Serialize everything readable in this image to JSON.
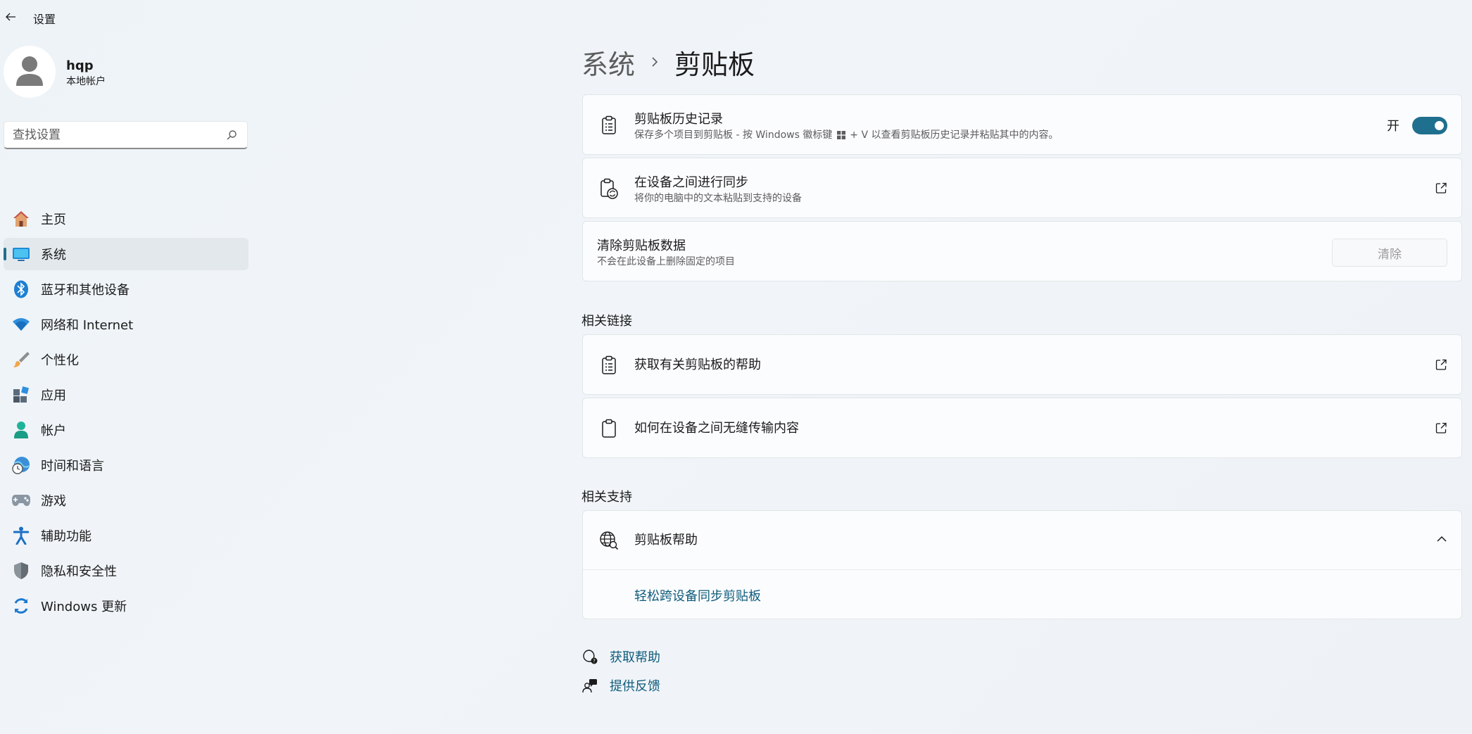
{
  "window": {
    "title": "设置"
  },
  "account": {
    "name": "hqp",
    "type": "本地帐户"
  },
  "search": {
    "placeholder": "查找设置"
  },
  "nav": [
    {
      "label": "主页",
      "icon": "home-icon"
    },
    {
      "label": "系统",
      "icon": "system-icon",
      "selected": true
    },
    {
      "label": "蓝牙和其他设备",
      "icon": "bluetooth-icon"
    },
    {
      "label": "网络和 Internet",
      "icon": "wifi-icon"
    },
    {
      "label": "个性化",
      "icon": "brush-icon"
    },
    {
      "label": "应用",
      "icon": "apps-icon"
    },
    {
      "label": "帐户",
      "icon": "account-icon"
    },
    {
      "label": "时间和语言",
      "icon": "time-language-icon"
    },
    {
      "label": "游戏",
      "icon": "gamepad-icon"
    },
    {
      "label": "辅助功能",
      "icon": "accessibility-icon"
    },
    {
      "label": "隐私和安全性",
      "icon": "shield-icon"
    },
    {
      "label": "Windows 更新",
      "icon": "update-icon"
    }
  ],
  "breadcrumb": {
    "parent": "系统",
    "current": "剪贴板"
  },
  "settings": {
    "history": {
      "title": "剪贴板历史记录",
      "desc_before": "保存多个项目到剪贴板 - 按 Windows 徽标键",
      "desc_after": "+ V 以查看剪贴板历史记录并粘贴其中的内容。",
      "toggle_label": "开",
      "toggle_on": true
    },
    "sync": {
      "title": "在设备之间进行同步",
      "desc": "将你的电脑中的文本粘贴到支持的设备"
    },
    "clear": {
      "title": "清除剪贴板数据",
      "desc": "不会在此设备上删除固定的项目",
      "button_label": "清除"
    }
  },
  "related_links": {
    "title": "相关链接",
    "items": [
      {
        "label": "获取有关剪贴板的帮助"
      },
      {
        "label": "如何在设备之间无缝传输内容"
      }
    ]
  },
  "related_support": {
    "title": "相关支持",
    "header": "剪贴板帮助",
    "link": "轻松跨设备同步剪贴板"
  },
  "footer": {
    "get_help": "获取帮助",
    "feedback": "提供反馈"
  },
  "colors": {
    "accent": "#1f6f8e",
    "link": "#0e5b7c"
  }
}
